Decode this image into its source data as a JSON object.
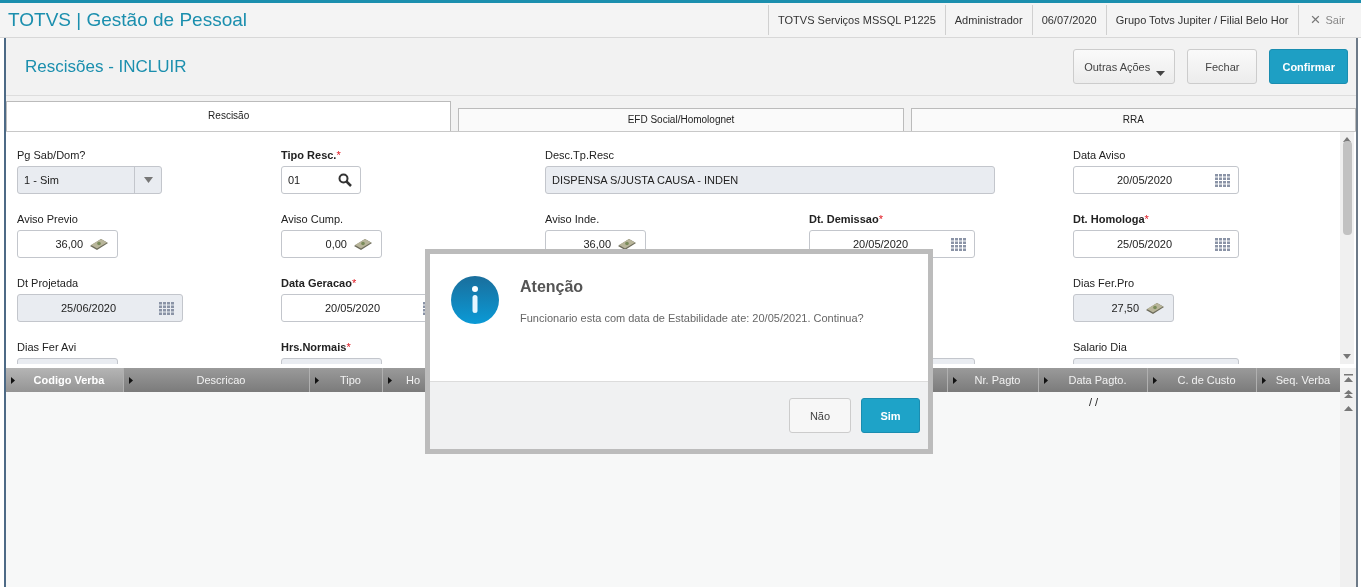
{
  "app": {
    "title": "TOTVS | Gestão de Pessoal",
    "info": [
      "TOTVS Serviços MSSQL P1225",
      "Administrador",
      "06/07/2020",
      "Grupo Totvs Jupiter / Filial Belo Hor"
    ],
    "exit": {
      "icon": "×",
      "label": "Sair"
    }
  },
  "page": {
    "title": "Rescisões - INCLUIR",
    "buttons": [
      {
        "label": "Outras Ações",
        "kind": "menu"
      },
      {
        "label": "Fechar",
        "kind": "plain"
      },
      {
        "label": "Confirmar",
        "kind": "primary"
      }
    ]
  },
  "tabs": [
    {
      "label": "Rescisão",
      "selected": true
    },
    {
      "label": "EFD Social/Homolognet",
      "selected": false
    },
    {
      "label": "RRA",
      "selected": false
    }
  ],
  "form_rows": [
    [
      {
        "label": "Pg Sab/Dom?",
        "value": "1 - Sim",
        "kind": "select",
        "readonly": true
      },
      {
        "label": "Tipo Resc.",
        "required_mark": "*",
        "value": "01",
        "kind": "lookup",
        "readonly": false
      },
      {
        "label": "Desc.Tp.Resc",
        "value": "DISPENSA S/JUSTA CAUSA - INDEN",
        "kind": "text",
        "readonly": true
      },
      null,
      {
        "label": "Data Aviso",
        "value": "20/05/2020",
        "kind": "date",
        "readonly": false
      }
    ],
    [
      {
        "label": "Aviso Previo",
        "value": "36,00",
        "kind": "number",
        "readonly": false
      },
      {
        "label": "Aviso Cump.",
        "value": "0,00",
        "kind": "number",
        "readonly": false
      },
      {
        "label": "Aviso Inde.",
        "value": "36,00",
        "kind": "number",
        "readonly": false
      },
      {
        "label": "Dt. Demissao",
        "required_mark": "*",
        "value": "20/05/2020",
        "kind": "date",
        "readonly": false
      },
      {
        "label": "Dt. Homologa",
        "required_mark": "*",
        "value": "25/05/2020",
        "kind": "date",
        "readonly": false
      }
    ],
    [
      {
        "label": "Dt Projetada",
        "value": "25/06/2020",
        "kind": "date",
        "readonly": true
      },
      {
        "label": "Data Geracao",
        "required_mark": "*",
        "value": "20/05/2020",
        "kind": "date",
        "readonly": false
      },
      null,
      null,
      {
        "label": "Dias Fer.Pro",
        "value": "27,50",
        "kind": "number",
        "readonly": true
      }
    ],
    [
      {
        "label": "Dias Fer Avi",
        "kind": "number",
        "readonly": true
      },
      {
        "label": "Hrs.Normais",
        "required_mark": "*",
        "kind": "number",
        "readonly": true
      },
      null,
      {
        "kind": "date",
        "readonly": true
      },
      {
        "label": "Salario Dia",
        "kind": "date",
        "readonly": true
      }
    ]
  ],
  "grid": {
    "columns": [
      {
        "label": "Codigo Verba",
        "selected": true
      },
      {
        "label": "Descricao",
        "selected": false
      },
      {
        "label": "Tipo",
        "selected": false
      },
      {
        "label": "Ho",
        "selected": false
      },
      {
        "selected": false
      },
      {
        "label": "Nr. Pagto",
        "selected": false
      },
      {
        "label": "Data Pagto.",
        "selected": false
      },
      {
        "label": "C. de Custo",
        "selected": false
      },
      {
        "label": "Seq. Verba",
        "selected": false
      }
    ],
    "rows": [
      {
        "cells": [
          null,
          null,
          null,
          null,
          null,
          null,
          "/ /",
          null,
          null
        ]
      }
    ]
  },
  "dialog": {
    "title": "Atenção",
    "message": "Funcionario esta com data de Estabilidade ate: 20/05/2021. Continua?",
    "buttons": [
      {
        "label": "Não",
        "kind": "plain"
      },
      {
        "label": "Sim",
        "kind": "primary"
      }
    ]
  }
}
